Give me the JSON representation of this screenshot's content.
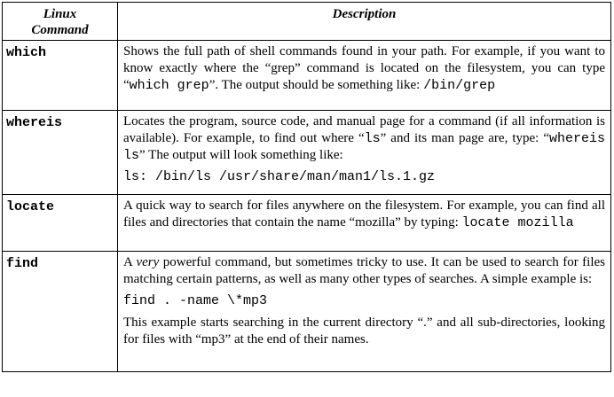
{
  "headers": {
    "command": "Linux Command",
    "command_line1": "Linux",
    "command_line2": "Command",
    "description": "Description"
  },
  "rows": [
    {
      "command": "which",
      "desc_before": "Shows the full path of shell commands found in your path.  For example, if you want to know exactly where the “grep” command is located on the filesystem, you can type “",
      "desc_code": "which grep",
      "desc_after": "”.  The output should be something like: ",
      "desc_code2": "/bin/grep"
    },
    {
      "command": "whereis",
      "desc_before": "Locates the program, source code, and manual page for a command (if all information is available).  For example, to find out where “",
      "desc_code": "ls",
      "desc_mid": "” and its man page are, type: “",
      "desc_code2": "whereis ls",
      "desc_after": "” The output will look something like:",
      "example": "ls: /bin/ls /usr/share/man/man1/ls.1.gz"
    },
    {
      "command": "locate",
      "desc_before": "A quick way to search for files anywhere on the filesystem.  For example, you can find all files and directories that contain the name “mozilla” by typing: ",
      "desc_code": "locate mozilla"
    },
    {
      "command": "find",
      "desc_pre": "A ",
      "desc_em": "very",
      "desc_before": " powerful command, but sometimes tricky to use.  It can be used to search for files matching certain patterns, as well as many other types of searches.  A simple example is:",
      "example": "find . -name \\*mp3",
      "note": "This example starts searching in the current directory “.” and all sub-directories, looking for files with “mp3” at the end of their names."
    }
  ]
}
